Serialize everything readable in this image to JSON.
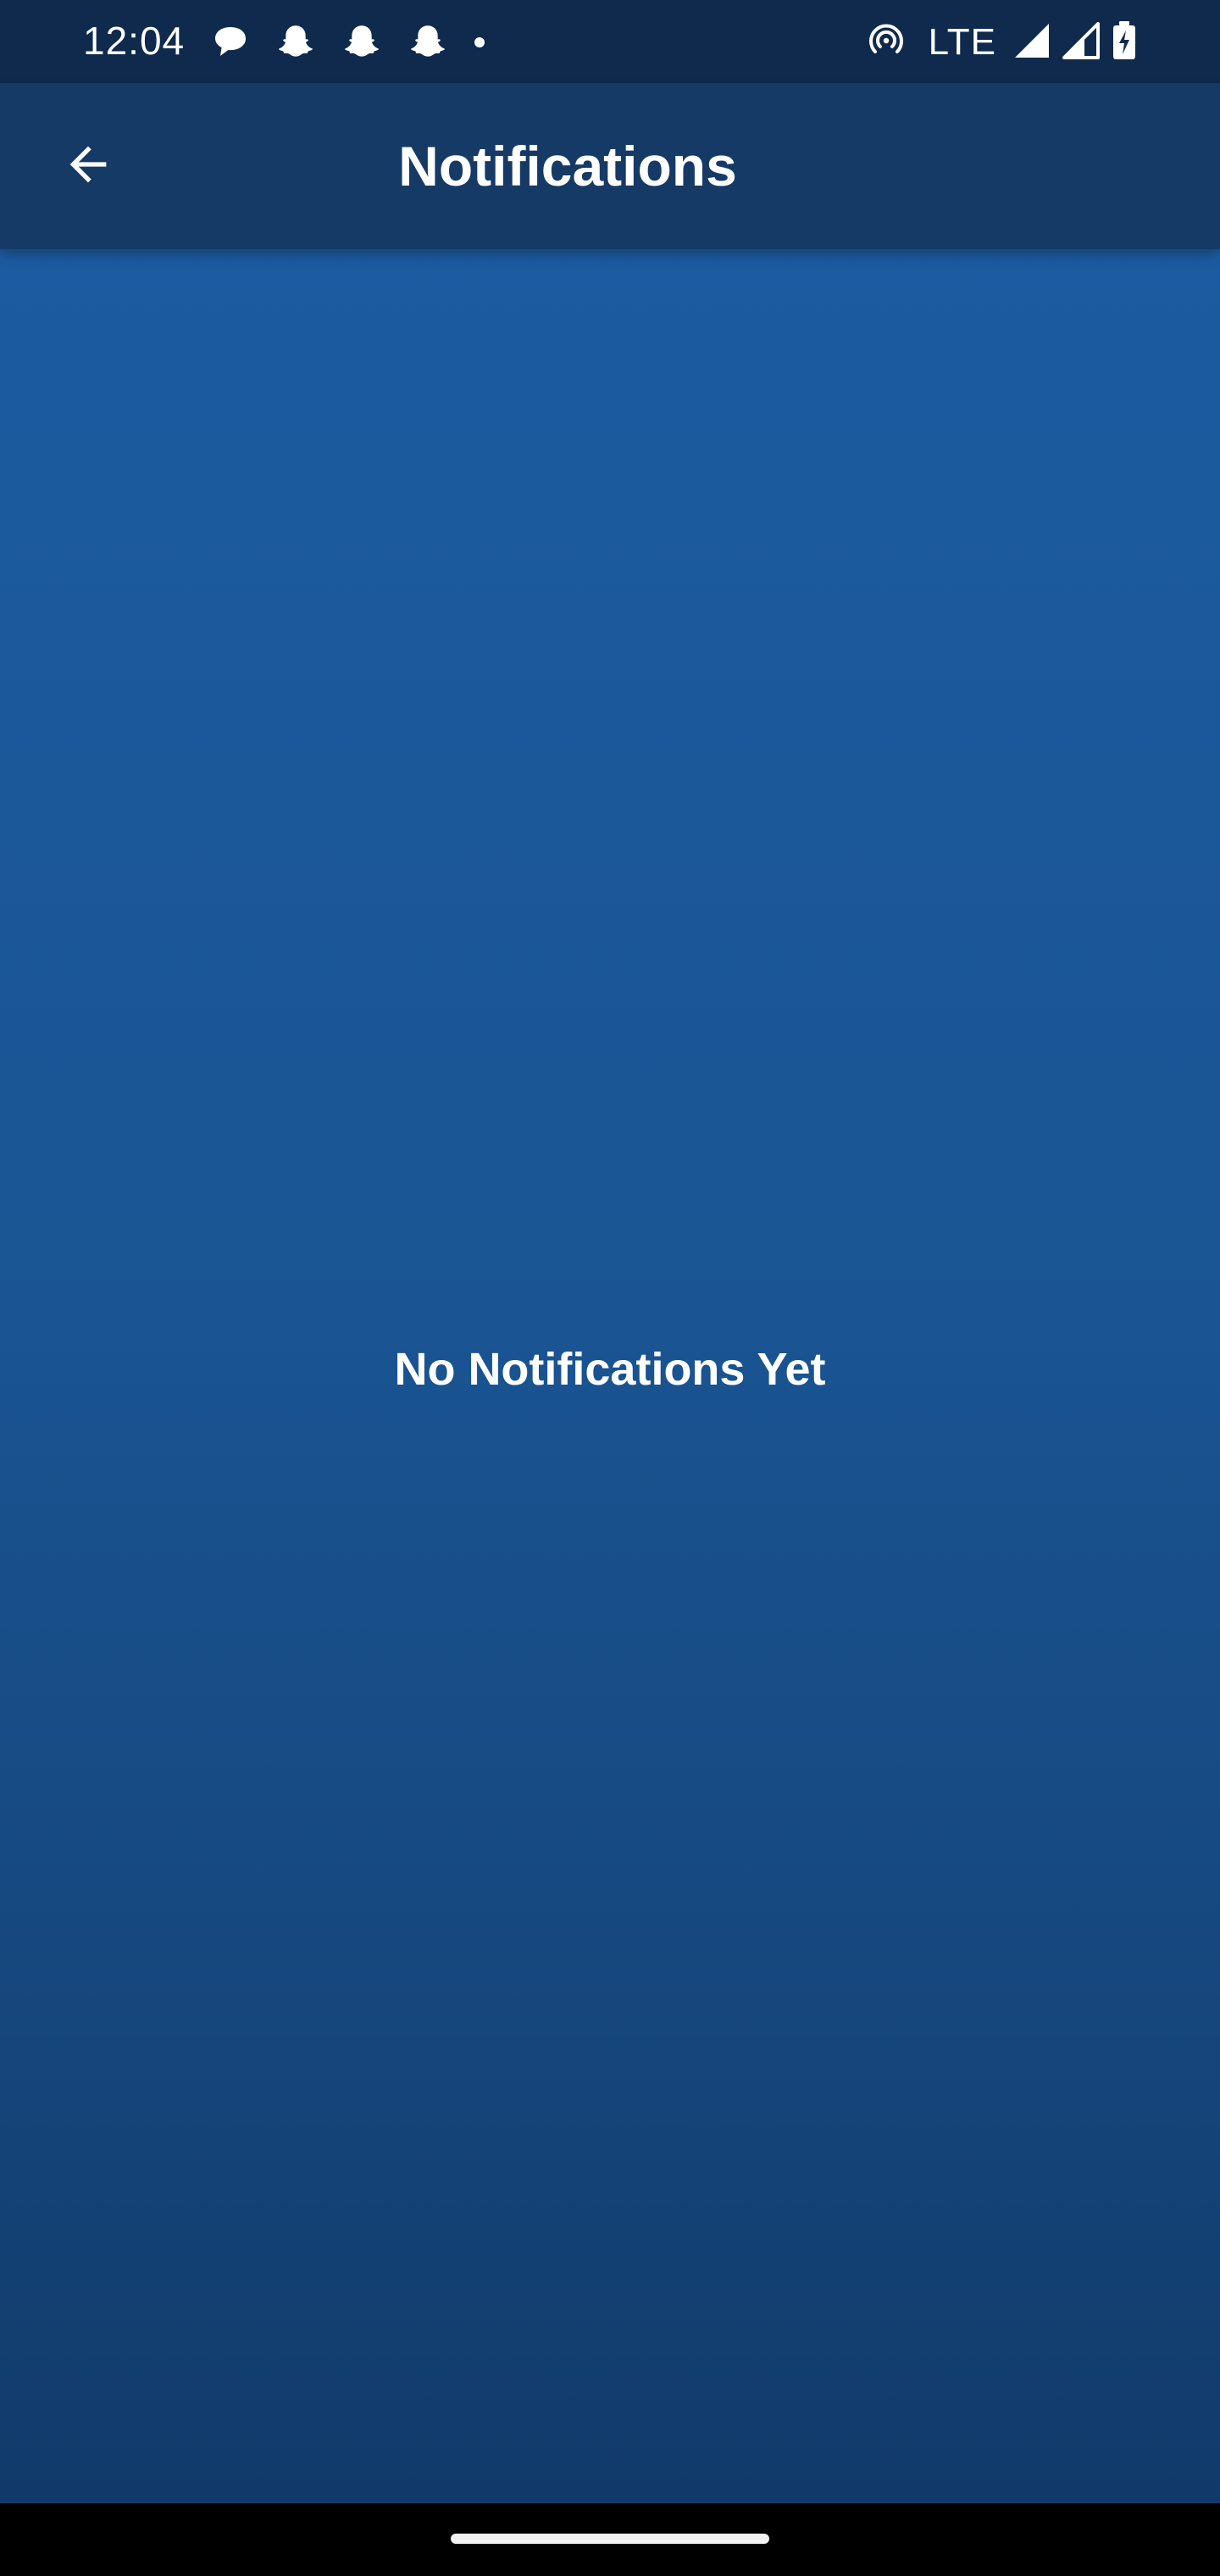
{
  "status_bar": {
    "time": "12:04",
    "left_icons": [
      "chat-bubble-icon",
      "snapchat-ghost-icon",
      "snapchat-ghost-icon",
      "snapchat-ghost-icon",
      "dot-icon"
    ],
    "network": "LTE",
    "right_icons": [
      "hotspot-icon",
      "cell-signal-full-icon",
      "cell-signal-partial-icon",
      "battery-charging-icon"
    ]
  },
  "app_bar": {
    "title": "Notifications",
    "back_icon": "arrow-back-icon"
  },
  "content": {
    "empty_message": "No Notifications Yet"
  },
  "colors": {
    "status_bar": "#0f2a4d",
    "app_bar": "#163a66",
    "content_top": "#1c5ba1",
    "content_bottom": "#113a6a",
    "text": "#ffffff",
    "nav_bar": "#000000"
  }
}
